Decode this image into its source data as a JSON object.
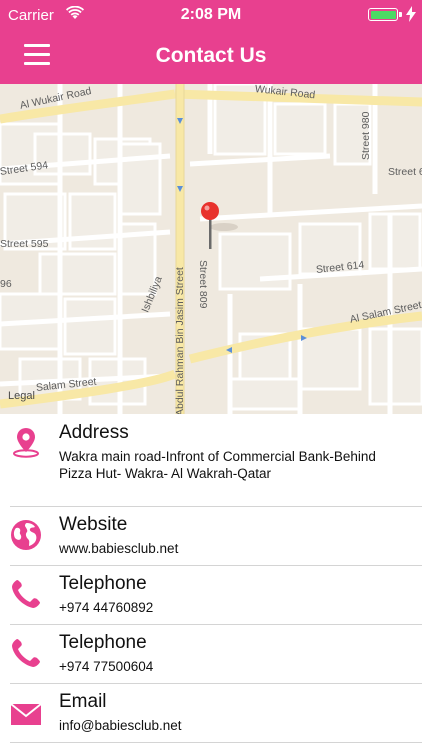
{
  "status_bar": {
    "carrier": "Carrier",
    "time": "2:08 PM",
    "battery_level": 1.0
  },
  "header": {
    "title": "Contact Us",
    "menu_icon": "hamburger-menu-icon"
  },
  "map": {
    "legal": "Legal",
    "streets": [
      "Al Wukair Road",
      "Wukair Road",
      "Street 594",
      "Street 595",
      "96",
      "Street 980",
      "Street 6",
      "Street 809",
      "Street 614",
      "Al Salam Street",
      "Salam Street",
      "Abdul Rahman Bin Jasim Street",
      "Ishbiliya"
    ],
    "pin_color": "#e8322d"
  },
  "contacts": [
    {
      "label": "Address",
      "value": "Wakra main road-Infront of Commercial Bank-Behind Pizza Hut- Wakra- Al Wakrah-Qatar",
      "icon": "location-pin-icon"
    },
    {
      "label": "Website",
      "value": "www.babiesclub.net",
      "icon": "globe-icon"
    },
    {
      "label": "Telephone",
      "value": "+974 44760892",
      "icon": "phone-icon"
    },
    {
      "label": "Telephone",
      "value": "+974 77500604",
      "icon": "phone-icon"
    },
    {
      "label": "Email",
      "value": "info@babiesclub.net",
      "icon": "envelope-icon"
    }
  ],
  "colors": {
    "accent": "#e8408f",
    "battery": "#4cd964"
  }
}
